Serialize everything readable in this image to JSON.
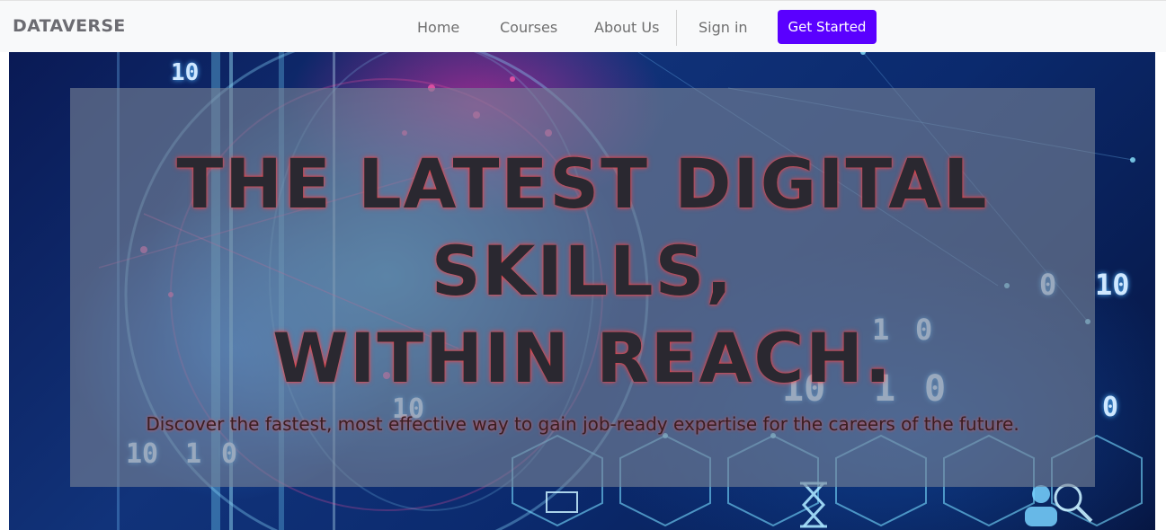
{
  "navbar": {
    "brand": "DATAVERSE",
    "links": [
      {
        "label": "Home"
      },
      {
        "label": "Courses"
      },
      {
        "label": "About Us"
      },
      {
        "label": "Sign in"
      }
    ],
    "cta_label": "Get Started",
    "cta_color": "#5a00ff"
  },
  "hero": {
    "headline_line1": "THE LATEST DIGITAL",
    "headline_line2": "SKILLS,",
    "headline_line3": "WITHIN REACH.",
    "subtext": "Discover the fastest, most effective way to gain job-ready expertise for the careers of the future.",
    "background_digits": [
      "0",
      "10",
      "1",
      "0",
      "10",
      "1",
      "0",
      "0",
      "10",
      "1",
      "0",
      "10",
      "10"
    ]
  }
}
